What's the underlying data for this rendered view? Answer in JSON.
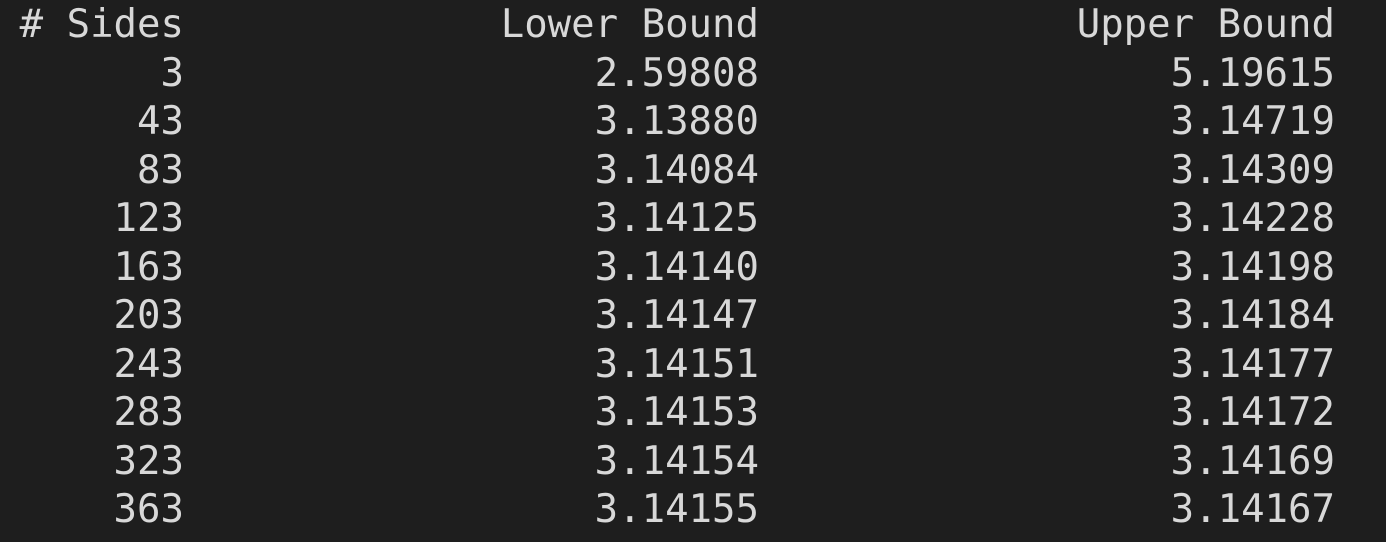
{
  "table": {
    "headers": {
      "sides": "# Sides",
      "lower": "Lower Bound",
      "upper": "Upper Bound"
    },
    "rows": [
      {
        "sides": "3",
        "lower": "2.59808",
        "upper": "5.19615"
      },
      {
        "sides": "43",
        "lower": "3.13880",
        "upper": "3.14719"
      },
      {
        "sides": "83",
        "lower": "3.14084",
        "upper": "3.14309"
      },
      {
        "sides": "123",
        "lower": "3.14125",
        "upper": "3.14228"
      },
      {
        "sides": "163",
        "lower": "3.14140",
        "upper": "3.14198"
      },
      {
        "sides": "203",
        "lower": "3.14147",
        "upper": "3.14184"
      },
      {
        "sides": "243",
        "lower": "3.14151",
        "upper": "3.14177"
      },
      {
        "sides": "283",
        "lower": "3.14153",
        "upper": "3.14172"
      },
      {
        "sides": "323",
        "lower": "3.14154",
        "upper": "3.14169"
      },
      {
        "sides": "363",
        "lower": "3.14155",
        "upper": "3.14167"
      }
    ]
  },
  "colors": {
    "background": "#1e1e1e",
    "text": "#d8d8d8"
  }
}
